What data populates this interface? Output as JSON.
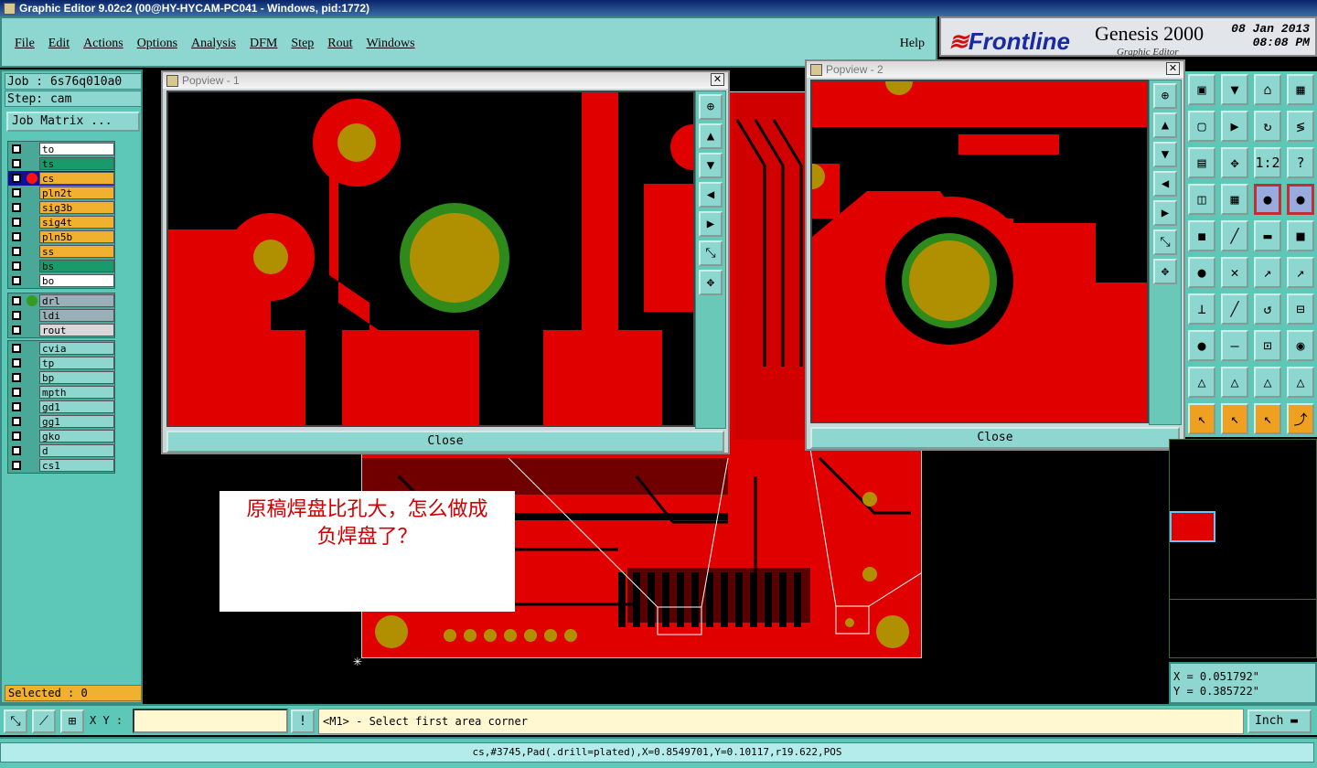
{
  "window": {
    "title": "Graphic Editor 9.02c2 (00@HY-HYCAM-PC041 - Windows, pid:1772)"
  },
  "menu": {
    "items": [
      "File",
      "Edit",
      "Actions",
      "Options",
      "Analysis",
      "DFM",
      "Step",
      "Rout",
      "Windows"
    ],
    "help": "Help"
  },
  "brand": {
    "logo": "Frontline",
    "product": "Genesis 2000",
    "subtitle": "Graphic Editor",
    "date": "08 Jan 2013",
    "time": "08:08 PM"
  },
  "job": {
    "label": "Job : 6s76q010a0",
    "step": "Step: cam",
    "matrix_button": "Job Matrix ..."
  },
  "layers": {
    "group1": [
      {
        "name": "to",
        "color": "#ffffff"
      },
      {
        "name": "ts",
        "color": "#1a9a6a"
      },
      {
        "name": "cs",
        "color": "#f0b030",
        "active": true
      },
      {
        "name": "pln2t",
        "color": "#f0b030"
      },
      {
        "name": "sig3b",
        "color": "#f0b030"
      },
      {
        "name": "sig4t",
        "color": "#f0b030"
      },
      {
        "name": "pln5b",
        "color": "#f0b030"
      },
      {
        "name": "ss",
        "color": "#f0b030"
      },
      {
        "name": "bs",
        "color": "#1a9a6a"
      },
      {
        "name": "bo",
        "color": "#ffffff"
      }
    ],
    "group2": [
      {
        "name": "drl",
        "color": "#9ab0b8"
      },
      {
        "name": "ldi",
        "color": "#9ab0b8"
      },
      {
        "name": "rout",
        "color": "#d8d8d8"
      }
    ],
    "group3": [
      {
        "name": "cvia",
        "color": "#8ed7d0"
      },
      {
        "name": "tp",
        "color": "#8ed7d0"
      },
      {
        "name": "bp",
        "color": "#8ed7d0"
      },
      {
        "name": "mpth",
        "color": "#8ed7d0"
      },
      {
        "name": "gd1",
        "color": "#8ed7d0"
      },
      {
        "name": "gg1",
        "color": "#8ed7d0"
      },
      {
        "name": "gko",
        "color": "#8ed7d0"
      },
      {
        "name": "d",
        "color": "#8ed7d0"
      },
      {
        "name": "cs1",
        "color": "#8ed7d0"
      }
    ]
  },
  "selected": "Selected : 0",
  "popview1": {
    "title": "Popview - 1",
    "close": "Close"
  },
  "popview2": {
    "title": "Popview - 2",
    "close": "Close"
  },
  "annotation": {
    "line1": "原稿焊盘比孔大，怎么做成",
    "line2": "负焊盘了？"
  },
  "coords": {
    "x": "X = 0.051792\"",
    "y": "Y = 0.385722\""
  },
  "bottom": {
    "xy_label": "X Y :",
    "xy_value": "",
    "prompt": "<M1> - Select first area corner",
    "unit": "Inch"
  },
  "status": "cs,#3745,Pad(.drill=plated),X=0.8549701,Y=0.10117,r19.622,POS"
}
